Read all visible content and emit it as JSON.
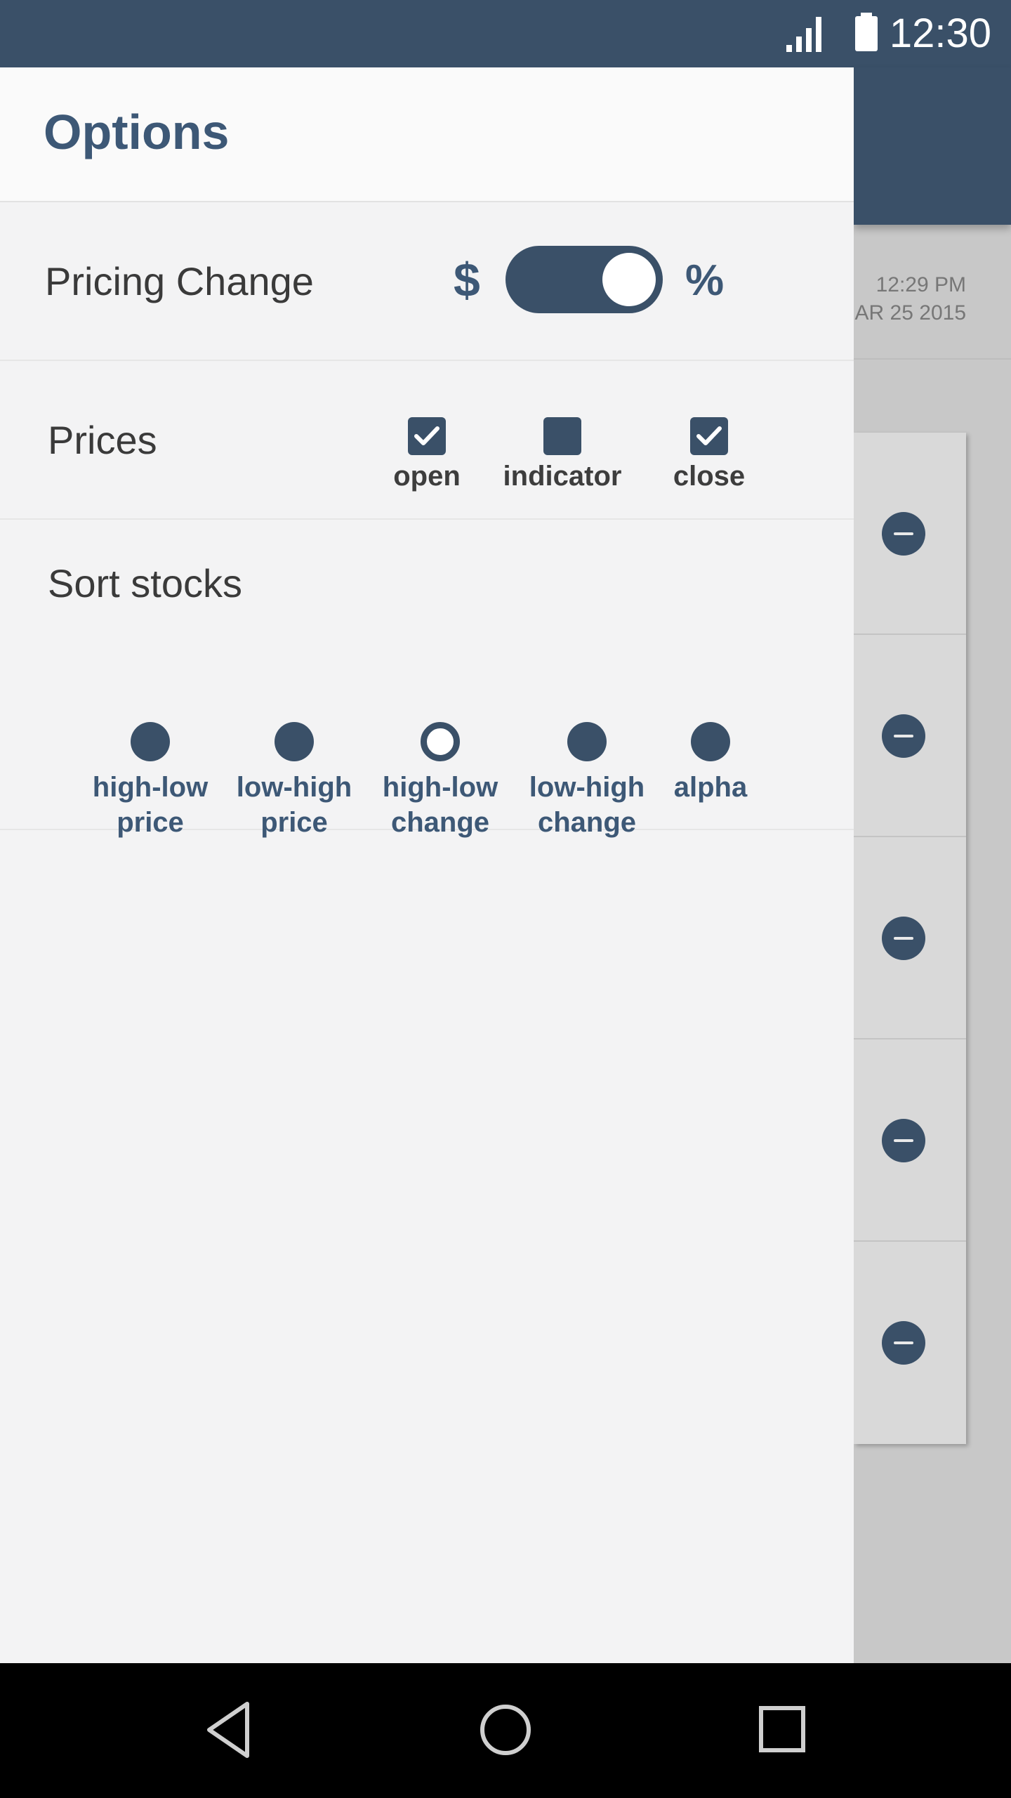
{
  "status_bar": {
    "time": "12:30",
    "icons": [
      "signal-icon",
      "battery-icon"
    ]
  },
  "background_app": {
    "timestamp_time": "12:29 PM",
    "timestamp_date": "AR 25 2015",
    "row_icons": [
      "remove-icon",
      "remove-icon",
      "remove-icon",
      "remove-icon",
      "remove-icon"
    ]
  },
  "drawer": {
    "title": "Options",
    "pricing_change": {
      "label": "Pricing Change",
      "left_symbol": "$",
      "right_symbol": "%",
      "selected": "%"
    },
    "prices": {
      "label": "Prices",
      "options": [
        {
          "label": "open",
          "checked": true
        },
        {
          "label": "indicator",
          "checked": false
        },
        {
          "label": "close",
          "checked": true
        }
      ]
    },
    "sort": {
      "label": "Sort stocks",
      "options": [
        {
          "line1": "high-low",
          "line2": "price",
          "selected": false
        },
        {
          "line1": "low-high",
          "line2": "price",
          "selected": false
        },
        {
          "line1": "high-low",
          "line2": "change",
          "selected": true
        },
        {
          "line1": "low-high",
          "line2": "change",
          "selected": false
        },
        {
          "line1": "alpha",
          "line2": "",
          "selected": false
        }
      ]
    }
  },
  "nav_bar": {
    "icons": [
      "back-icon",
      "home-icon",
      "recents-icon"
    ]
  },
  "colors": {
    "primary": "#3a5068",
    "drawer_bg": "#f3f3f4",
    "header_bg": "#fafafa"
  }
}
